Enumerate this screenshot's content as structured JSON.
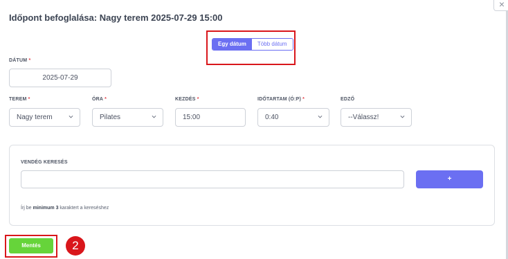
{
  "modal": {
    "title": "Időpont befoglalása: Nagy terem 2025-07-29 15:00",
    "close_glyph": "×"
  },
  "date_mode": {
    "single_label": "Egy dátum",
    "multi_label": "Több dátum",
    "selected": "single"
  },
  "form": {
    "required_mark": "*",
    "date": {
      "label": "DÁTUM",
      "value": "2025-07-29"
    },
    "room": {
      "label": "TEREM",
      "value": "Nagy terem"
    },
    "class": {
      "label": "ÓRA",
      "value": "Pilates"
    },
    "start": {
      "label": "KEZDÉS",
      "value": "15:00"
    },
    "duration": {
      "label": "IDŐTARTAM (Ó:P)",
      "value": "0:40"
    },
    "trainer": {
      "label": "EDZŐ",
      "value": "--Válassz!"
    }
  },
  "guest_search": {
    "label": "VENDÉG KERESÉS",
    "value": "",
    "add_label": "+",
    "hint_prefix": "Írj be",
    "hint_bold": "minimum 3",
    "hint_suffix": "karaktert a kereséshez"
  },
  "actions": {
    "save_label": "Mentés"
  },
  "annotations": {
    "step_number": "2",
    "highlight_color": "#d9161b"
  },
  "colors": {
    "accent": "#6b6ff2",
    "save": "#66d43a",
    "required": "#e2424a"
  },
  "icons": {
    "dropdown": "chevron-down-icon",
    "close": "close-icon"
  }
}
